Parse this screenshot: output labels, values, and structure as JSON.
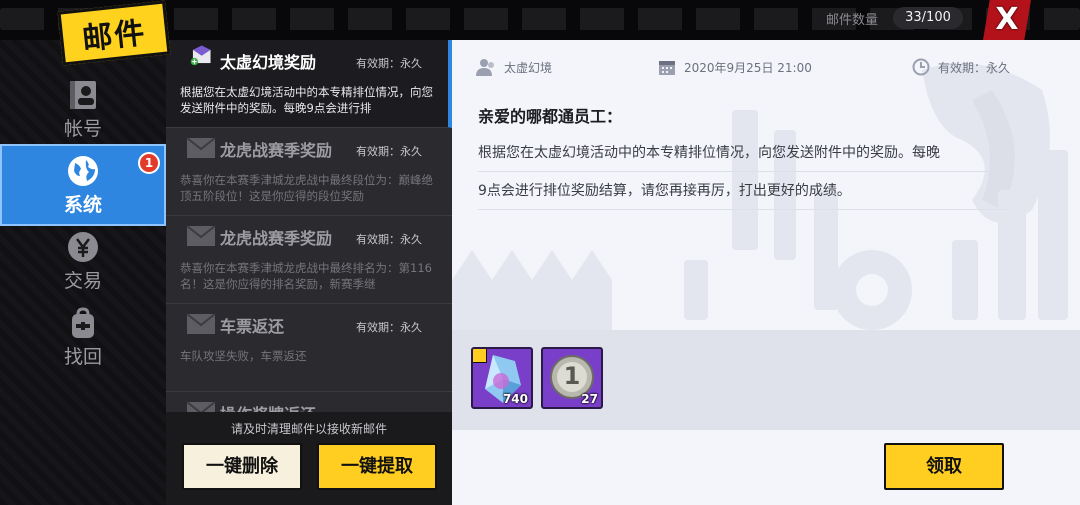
{
  "header": {
    "title": "邮件",
    "mail_count_label": "邮件数量",
    "mail_count": "33/100",
    "close_symbol": "X"
  },
  "nav": {
    "items": [
      {
        "label": "帐号",
        "icon": "account-card-icon"
      },
      {
        "label": "系统",
        "icon": "globe-icon",
        "badge": "1"
      },
      {
        "label": "交易",
        "icon": "yen-coin-icon"
      },
      {
        "label": "找回",
        "icon": "backpack-icon"
      }
    ]
  },
  "mail_list": {
    "items": [
      {
        "title": "太虚幻境奖励",
        "expiry": "有效期：永久",
        "preview": "根据您在太虚幻境活动中的本专精排位情况，向您发送附件中的奖励。每晚9点会进行排"
      },
      {
        "title": "龙虎战赛季奖励",
        "expiry": "有效期：永久",
        "preview": "恭喜你在本赛季津城龙虎战中最终段位为：巅峰绝顶五阶段位！这是你应得的段位奖励"
      },
      {
        "title": "龙虎战赛季奖励",
        "expiry": "有效期：永久",
        "preview": "恭喜你在本赛季津城龙虎战中最终排名为：第116名！这是你应得的排名奖励，新赛季继"
      },
      {
        "title": "车票返还",
        "expiry": "有效期：永久",
        "preview": "车队攻坚失败，车票返还"
      },
      {
        "title": "操作奖牌返还",
        "expiry": "",
        "preview": ""
      }
    ],
    "footer_tip": "请及时清理邮件以接收新邮件",
    "delete_all_label": "一键删除",
    "claim_all_label": "一键提取"
  },
  "detail": {
    "sender": "太虚幻境",
    "date": "2020年9月25日  21:00",
    "expiry": "有效期：永久",
    "greeting": "亲爱的哪都通员工：",
    "body_lines": [
      "根据您在太虚幻境活动中的本专精排位情况，向您发送附件中的奖励。每晚",
      "9点会进行排位奖励结算，请您再接再厉，打出更好的成绩。"
    ],
    "attachments": [
      {
        "icon": "crystal-shard-icon",
        "qty": "740"
      },
      {
        "icon": "silver-coin-icon",
        "qty": "27",
        "coin_text": "1"
      }
    ],
    "claim_label": "领取"
  },
  "colors": {
    "accent_blue": "#2f86e0",
    "button_yellow": "#ffce20",
    "badge_red": "#e23b2c",
    "close_red": "#b3121a",
    "item_purple": "#7a3fc8"
  }
}
